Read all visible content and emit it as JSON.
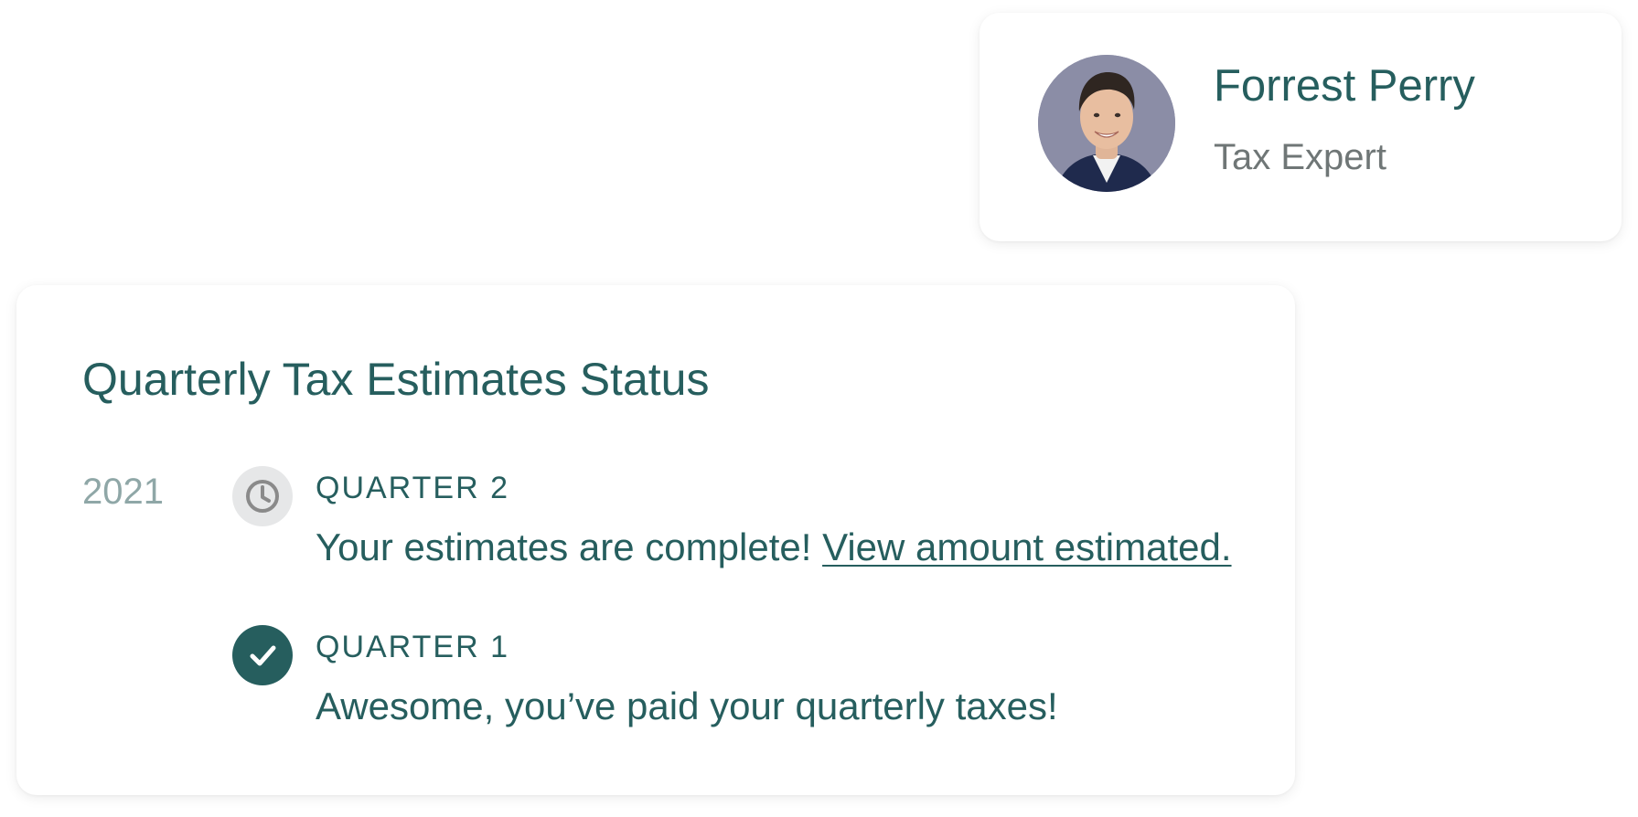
{
  "expert": {
    "name": "Forrest Perry",
    "role": "Tax Expert",
    "avatar_icon": "person-photo-avatar"
  },
  "status": {
    "title": "Quarterly Tax Estimates Status",
    "year": "2021",
    "quarters": [
      {
        "label": "QUARTER 2",
        "state_icon": "clock-icon",
        "message": "Your estimates are complete!",
        "link_text": "View amount estimated."
      },
      {
        "label": "QUARTER 1",
        "state_icon": "checkmark-icon",
        "message": "Awesome, you’ve paid your quarterly taxes!"
      }
    ]
  },
  "colors": {
    "brand_teal": "#265e5e",
    "muted_year": "#8fa7a7",
    "muted_role": "#6f7676",
    "pending_bg": "#e6e7e8",
    "pending_icon": "#8a8a8a"
  }
}
